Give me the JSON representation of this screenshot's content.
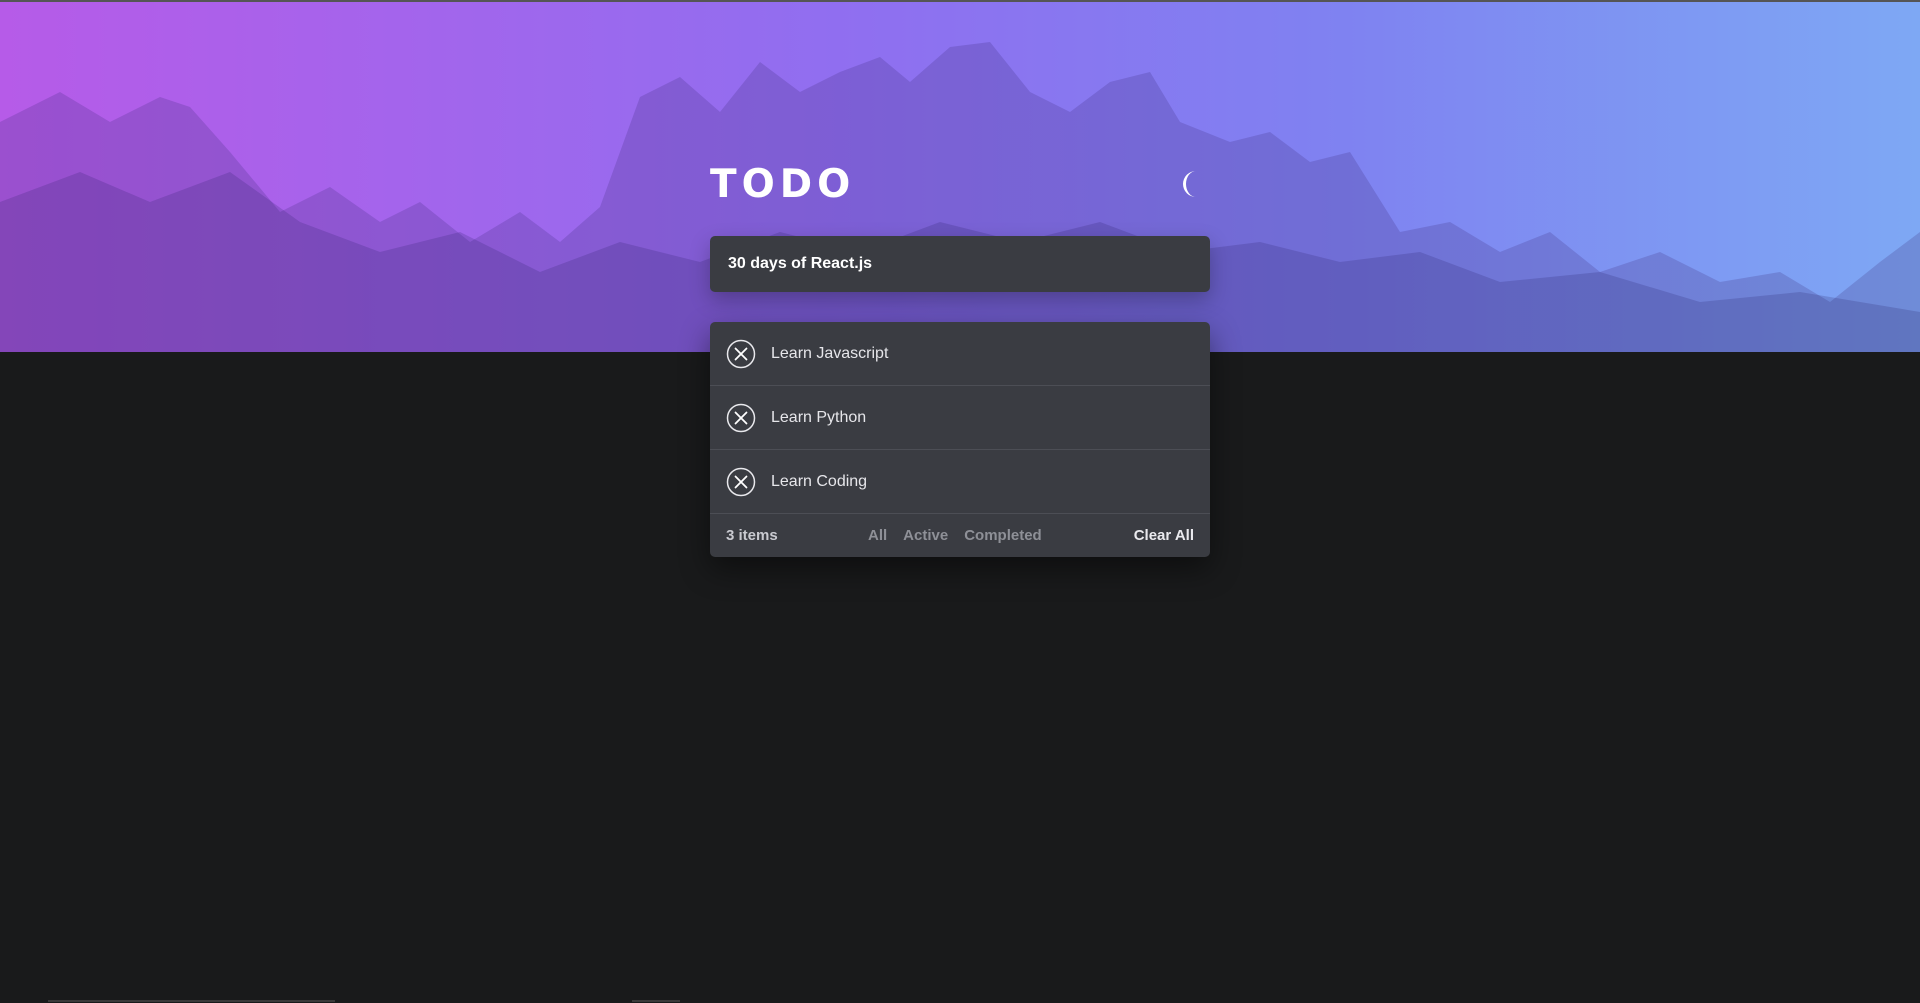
{
  "header": {
    "title": "TODO",
    "theme_icon": "moon-icon"
  },
  "new_todo": {
    "value": "30 days of React.js"
  },
  "todos": [
    {
      "text": "Learn Javascript",
      "icon": "close-circle-icon"
    },
    {
      "text": "Learn Python",
      "icon": "close-circle-icon"
    },
    {
      "text": "Learn Coding",
      "icon": "close-circle-icon"
    }
  ],
  "footer": {
    "count": "3 items",
    "filters": [
      "All",
      "Active",
      "Completed"
    ],
    "clear_label": "Clear All"
  },
  "colors": {
    "gradient_start": "#b65be8",
    "gradient_end": "#7ea8f4",
    "background": "#191a1b",
    "card": "#3a3c42"
  }
}
